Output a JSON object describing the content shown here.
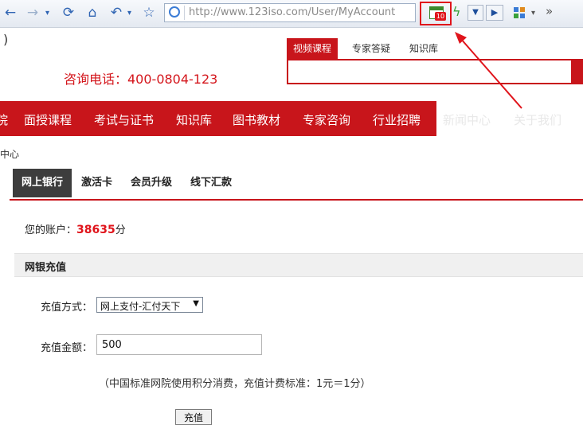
{
  "browser": {
    "url": "http://www.123iso.com/User/MyAccount",
    "extension_badge": "10",
    "overflow_chevron": "»"
  },
  "site": {
    "paren": ")",
    "phone": "咨询电话：400-0804-123",
    "search_tabs": [
      "视频课程",
      "专家答疑",
      "知识库"
    ],
    "nav_items": [
      "院",
      "面授课程",
      "考试与证书",
      "知识库",
      "图书教材",
      "专家咨询",
      "行业招聘"
    ],
    "nav_faint": [
      "新闻中心",
      "关于我们"
    ],
    "breadcrumb": "中心"
  },
  "account": {
    "tabs": [
      "网上银行",
      "激活卡",
      "会员升级",
      "线下汇款"
    ],
    "balance_label": "您的账户：",
    "balance_value": "38635",
    "balance_unit": "分",
    "section_title": "网银充值",
    "method_label": "充值方式：",
    "method_value": "网上支付-汇付天下",
    "amount_label": "充值金额：",
    "amount_value": "500",
    "note": "（中国标准网院使用积分消费，充值计费标准：1元＝1分）",
    "submit_label": "充值"
  },
  "colors": {
    "brand_red": "#c8151b",
    "highlight_red": "#e0141b",
    "tab_dark": "#3d3d3d"
  }
}
